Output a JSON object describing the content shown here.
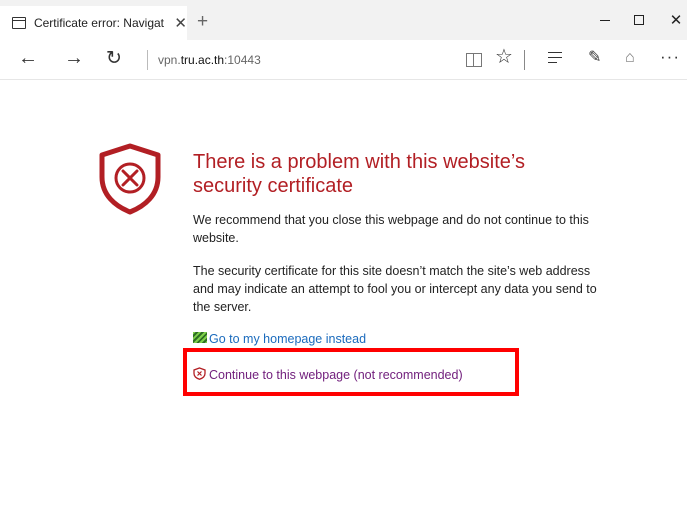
{
  "tab": {
    "title": "Certificate error: Navigat",
    "close": "✕",
    "new_tab": "+"
  },
  "window_controls": {
    "close": "✕"
  },
  "nav": {
    "back": "←",
    "forward": "→",
    "refresh": "↻"
  },
  "address": {
    "prefix": "vpn.",
    "domain": "tru.ac.th",
    "port": ":10443"
  },
  "toolbar": {
    "favorite": "☆",
    "note": "✎",
    "share": "⌂",
    "more": "···"
  },
  "content": {
    "heading": "There is a problem with this website’s security certificate",
    "paragraph_1": "We recommend that you close this webpage and do not continue to this website.",
    "paragraph_2": "The security certificate for this site doesn’t match the site’s web address and may indicate an attempt to fool you or intercept any data you send to the server.",
    "home_link": "Go to my homepage instead",
    "continue_link": "Continue to this webpage (not recommended)"
  },
  "colors": {
    "heading": "#b21f24",
    "shield": "#b21f24",
    "home_link": "#1b6bbd",
    "continue_link": "#72207d",
    "highlight_box": "#ff0000"
  }
}
